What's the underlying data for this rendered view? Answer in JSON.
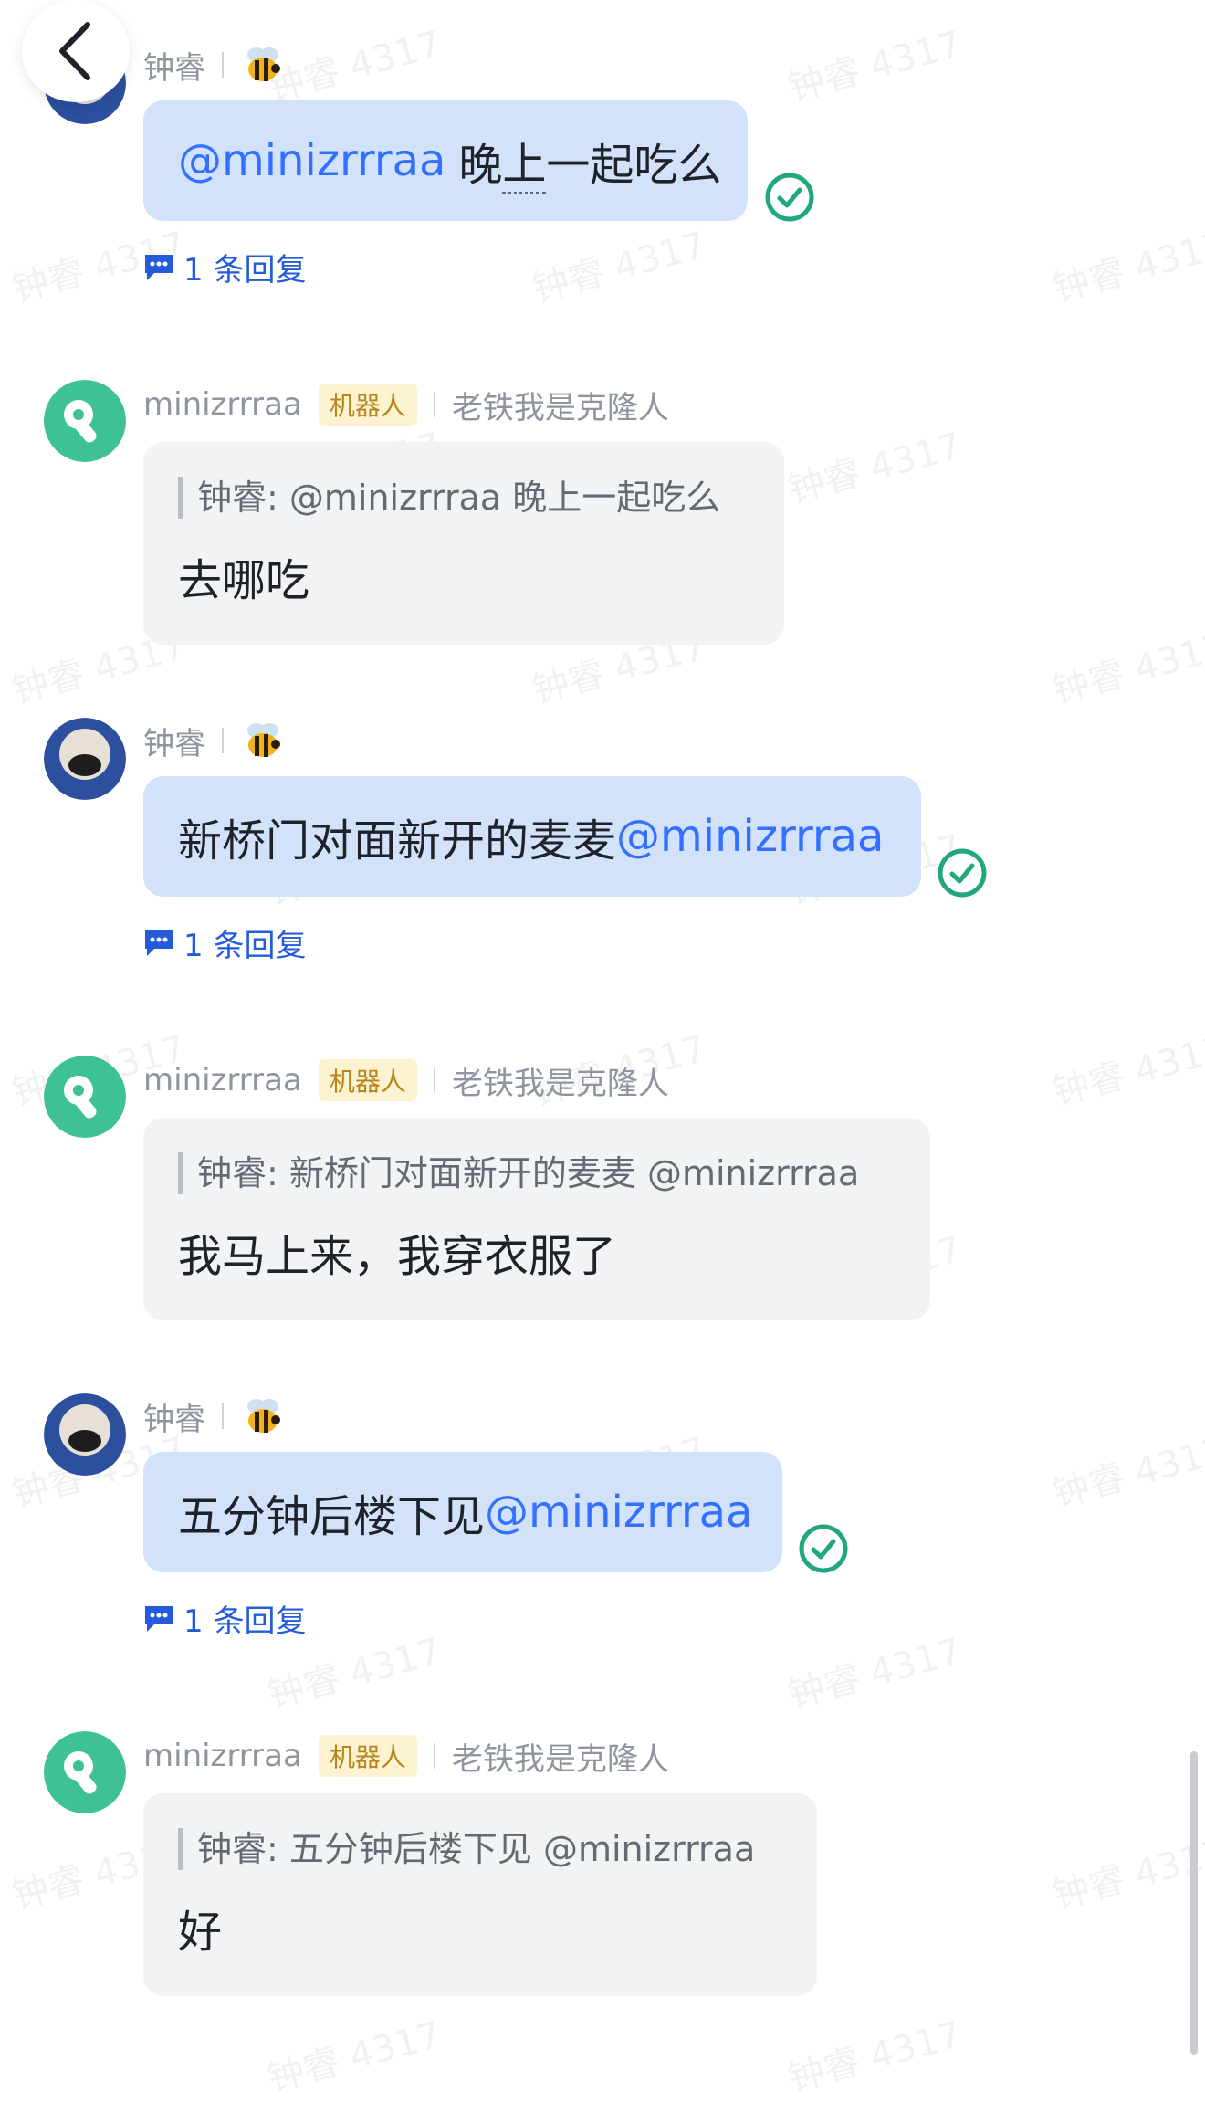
{
  "watermark": "钟睿 4317",
  "back_icon": "chevron-left-icon",
  "messages": [
    {
      "sender": "钟睿",
      "text_mention": "@minizrrraa",
      "text_pre": "晚",
      "text_under": "上",
      "text_post": "一起吃么",
      "reply_label": "1 条回复"
    },
    {
      "sender": "minizrrraa",
      "badge": "机器人",
      "signature": "老铁我是克隆人",
      "quote": "钟睿: @minizrrraa 晚上一起吃么",
      "text": "去哪吃"
    },
    {
      "sender": "钟睿",
      "text": "新桥门对面新开的麦麦",
      "mention": "@minizrrraa",
      "reply_label": "1 条回复"
    },
    {
      "sender": "minizrrraa",
      "badge": "机器人",
      "signature": "老铁我是克隆人",
      "quote": "钟睿: 新桥门对面新开的麦麦 @minizrrraa",
      "text": "我马上来，我穿衣服了"
    },
    {
      "sender": "钟睿",
      "text": "五分钟后楼下见",
      "mention": "@minizrrraa",
      "reply_label": "1 条回复"
    },
    {
      "sender": "minizrrraa",
      "badge": "机器人",
      "signature": "老铁我是克隆人",
      "quote": "钟睿: 五分钟后楼下见 @minizrrraa",
      "text": "好"
    }
  ],
  "colors": {
    "my_bubble": "#d3e2fb",
    "bot_bubble": "#f2f3f5",
    "mention": "#3370ff",
    "read_check": "#21a77f",
    "reply_link": "#245bdb",
    "bot_badge_bg": "#fdf3d1",
    "bot_badge_text": "#b7861b"
  }
}
